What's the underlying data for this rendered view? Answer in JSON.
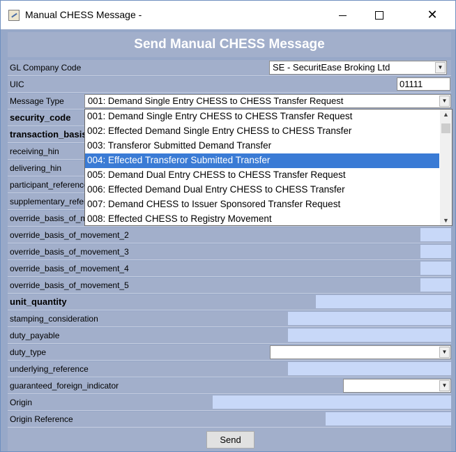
{
  "window": {
    "title": "Manual CHESS Message -"
  },
  "header": {
    "title": "Send Manual CHESS Message"
  },
  "form": {
    "gl_company_code": {
      "label": "GL Company Code",
      "value": "SE - SecuritEase Broking Ltd"
    },
    "uic": {
      "label": "UIC",
      "value": "01111"
    },
    "message_type": {
      "label": "Message Type",
      "value": "001: Demand Single Entry CHESS to CHESS Transfer Request"
    },
    "fields": [
      {
        "label": "security_code",
        "bold": true
      },
      {
        "label": "transaction_basis",
        "bold": true
      },
      {
        "label": "receiving_hin",
        "bold": false
      },
      {
        "label": "delivering_hin",
        "bold": false
      },
      {
        "label": "participant_reference",
        "bold": false
      },
      {
        "label": "supplementary_reference",
        "bold": false
      },
      {
        "label": "override_basis_of_movement_1",
        "bold": false
      },
      {
        "label": "override_basis_of_movement_2",
        "bold": false
      },
      {
        "label": "override_basis_of_movement_3",
        "bold": false
      },
      {
        "label": "override_basis_of_movement_4",
        "bold": false
      },
      {
        "label": "override_basis_of_movement_5",
        "bold": false
      },
      {
        "label": "unit_quantity",
        "bold": true
      },
      {
        "label": "stamping_consideration",
        "bold": false
      },
      {
        "label": "duty_payable",
        "bold": false
      },
      {
        "label": "duty_type",
        "bold": false
      },
      {
        "label": "underlying_reference",
        "bold": false
      },
      {
        "label": "guaranteed_foreign_indicator",
        "bold": false
      },
      {
        "label": "Origin",
        "bold": false
      },
      {
        "label": "Origin Reference",
        "bold": false
      }
    ]
  },
  "dropdown": {
    "options": [
      "001: Demand Single Entry CHESS to CHESS Transfer Request",
      "002: Effected Demand Single Entry CHESS to CHESS Transfer",
      "003: Transferor Submitted Demand Transfer",
      "004: Effected Transferor Submitted Transfer",
      "005: Demand Dual Entry CHESS to CHESS Transfer Request",
      "006: Effected Demand Dual Entry CHESS to CHESS Transfer",
      "007: Demand CHESS to Issuer Sponsored Transfer Request",
      "008: Effected CHESS to Registry Movement"
    ],
    "highlighted": "004: Effected Transferor Submitted Transfer"
  },
  "footer": {
    "send_label": "Send"
  },
  "colors": {
    "panel": "#a2afcb",
    "field": "#c8d8f8",
    "highlight": "#3a7bd5"
  }
}
